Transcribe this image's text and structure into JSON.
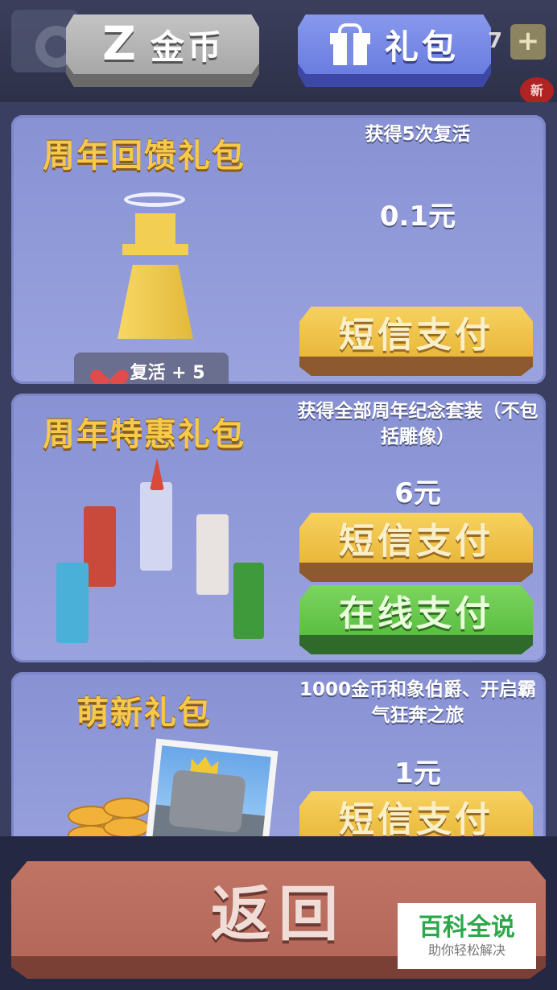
{
  "top": {
    "coin_count_partial": "7",
    "new_badge": "新",
    "tabs": [
      {
        "label": "金币",
        "icon": "coin-z-icon",
        "active": false
      },
      {
        "label": "礼包",
        "icon": "gift-icon",
        "active": true
      }
    ]
  },
  "packs": [
    {
      "title": "周年回馈礼包",
      "description": "获得5次复活",
      "price": "0.1元",
      "buttons": [
        "短信支付"
      ],
      "badge": "复活 + 5"
    },
    {
      "title": "周年特惠礼包",
      "description": "获得全部周年纪念套装（不包括雕像）",
      "price": "6元",
      "buttons": [
        "短信支付",
        "在线支付"
      ]
    },
    {
      "title": "萌新礼包",
      "description": "1000金币和象伯爵、开启霸气狂奔之旅",
      "price": "1元",
      "buttons": [
        "短信支付"
      ]
    }
  ],
  "footer": {
    "back_label": "返回"
  },
  "watermark": {
    "title": "百科全说",
    "subtitle": "助你轻松解决"
  },
  "colors": {
    "sms_button": "#e9b83b",
    "online_button": "#5bbf43",
    "back_button": "#b4685a",
    "card_bg": "#8892d4",
    "title_gold": "#f5c94a"
  }
}
